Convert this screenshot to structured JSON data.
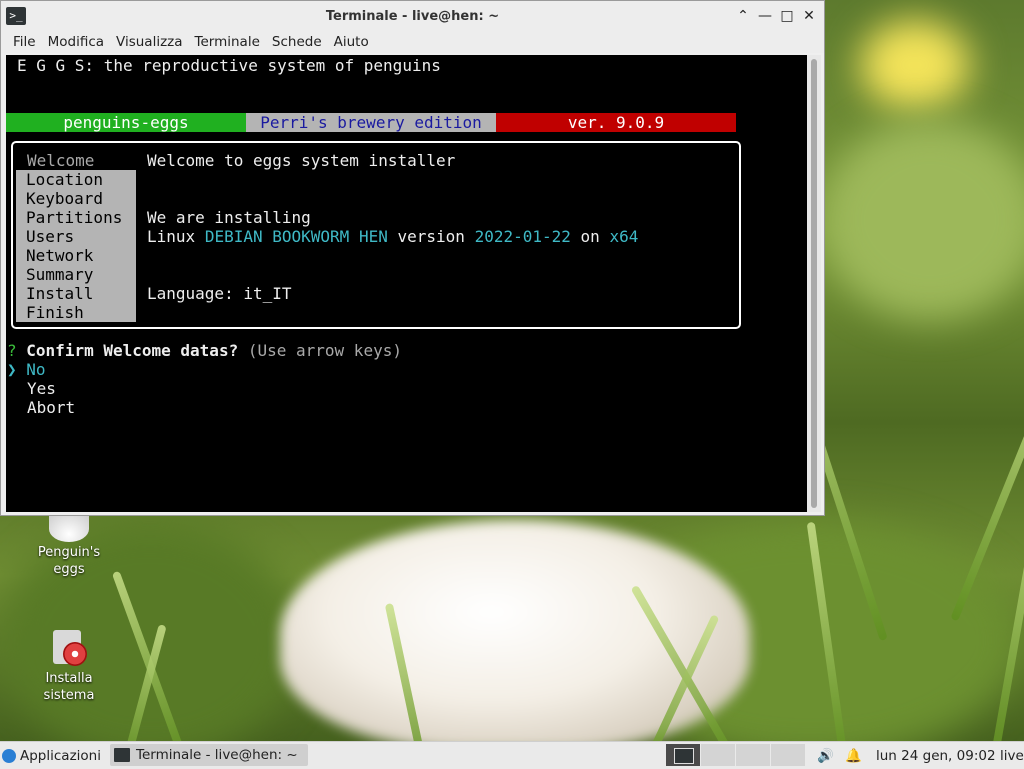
{
  "window": {
    "title": "Terminale - live@hen: ~",
    "menu": [
      "File",
      "Modifica",
      "Visualizza",
      "Terminale",
      "Schede",
      "Aiuto"
    ]
  },
  "terminal": {
    "header": "E G G S: the reproductive system of penguins",
    "bar": {
      "left": "penguins-eggs",
      "middle": "Perri's brewery edition",
      "right": "ver. 9.0.9",
      "colors": {
        "left": "#20b020",
        "middle": "#b4b4b4",
        "right": "#c00000"
      }
    },
    "sidebar": [
      "Welcome",
      "Location",
      "Keyboard",
      "Partitions",
      "Users",
      "Network",
      "Summary",
      "Install",
      "Finish"
    ],
    "content": {
      "heading": "Welcome to eggs system installer",
      "installing": "We are installing",
      "linux_prefix": "Linux",
      "distro": "DEBIAN BOOKWORM HEN",
      "version_word": "version",
      "version_date": "2022-01-22",
      "on_word": "on",
      "arch": "x64",
      "language": "Language: it_IT"
    },
    "prompt": {
      "mark": "?",
      "question": "Confirm Welcome datas?",
      "hint": "(Use arrow keys)",
      "pointer": "❯",
      "options": [
        "No",
        "Yes",
        "Abort"
      ]
    }
  },
  "desktop": {
    "icons": [
      {
        "label_line1": "Penguin's",
        "label_line2": "eggs"
      },
      {
        "label_line1": "Installa",
        "label_line2": "sistema"
      }
    ]
  },
  "taskbar": {
    "apps_label": "Applicazioni",
    "task_label": "Terminale - live@hen: ~",
    "clock": "lun 24 gen, 09:02",
    "user": "live"
  }
}
